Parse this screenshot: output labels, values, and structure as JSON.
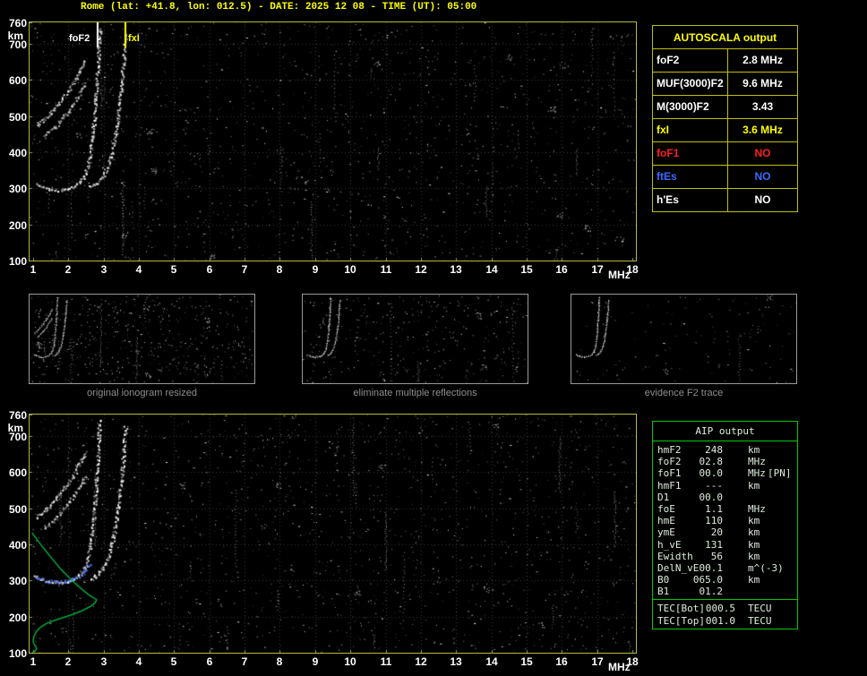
{
  "title": "Rome (lat: +41.8, lon: 012.5) - DATE: 2025 12 08 - TIME (UT): 05:00",
  "colors": {
    "background": "#000000",
    "title_text": "#ffff00",
    "plot_border": "#b9b93c",
    "axis_text": "#ffffff",
    "autoscala_border": "#c0c000",
    "autoscala_header_text": "#ffff00",
    "aip_border": "#00c800",
    "aip_text": "#ddeedd",
    "caption_text": "#8f8f8f",
    "profile_green": "#00c040",
    "fitted_blue": "#5577ff"
  },
  "autoscala_table": {
    "header": "AUTOSCALA output",
    "rows": [
      {
        "label": "foF2",
        "value": "2.8 MHz",
        "color": "#ffffff"
      },
      {
        "label": "MUF(3000)F2",
        "value": "9.6 MHz",
        "color": "#ffffff"
      },
      {
        "label": "M(3000)F2",
        "value": "3.43",
        "color": "#ffffff"
      },
      {
        "label": "fxI",
        "value": "3.6 MHz",
        "color": "#ffff00"
      },
      {
        "label": "foF1",
        "value": "NO",
        "color": "#ff2020"
      },
      {
        "label": "ftEs",
        "value": "NO",
        "color": "#3b6bff"
      },
      {
        "label": "h'Es",
        "value": "NO",
        "color": "#ffffff"
      }
    ]
  },
  "aip_table": {
    "header": "AIP output",
    "rows": [
      {
        "label": "hmF2",
        "value": "248",
        "unit": "km",
        "extra": ""
      },
      {
        "label": "foF2",
        "value": "02.8",
        "unit": "MHz",
        "extra": ""
      },
      {
        "label": "foF1",
        "value": "00.0",
        "unit": "MHz",
        "extra": "[PN]"
      },
      {
        "label": "hmF1",
        "value": "---",
        "unit": "km",
        "extra": ""
      },
      {
        "label": "D1",
        "value": "00.0",
        "unit": "",
        "extra": ""
      },
      {
        "label": "foE",
        "value": "1.1",
        "unit": "MHz",
        "extra": ""
      },
      {
        "label": "hmE",
        "value": "110",
        "unit": "km",
        "extra": ""
      },
      {
        "label": "ymE",
        "value": "20",
        "unit": "km",
        "extra": ""
      },
      {
        "label": "h_vE",
        "value": "131",
        "unit": "km",
        "extra": ""
      },
      {
        "label": "Ewidth",
        "value": "56",
        "unit": "km",
        "extra": ""
      },
      {
        "label": "DelN_vE",
        "value": "00.1",
        "unit": "m^(-3)",
        "extra": ""
      },
      {
        "label": "B0",
        "value": "065.0",
        "unit": "km",
        "extra": ""
      },
      {
        "label": "B1",
        "value": "01.2",
        "unit": "",
        "extra": ""
      }
    ],
    "tec_rows": [
      {
        "label": "TEC[Bot]",
        "value": "000.5",
        "unit": "TECU"
      },
      {
        "label": "TEC[Top]",
        "value": "001.0",
        "unit": "TECU"
      }
    ]
  },
  "thumbnails": [
    {
      "caption": "original ionogram resized"
    },
    {
      "caption": "eliminate multiple reflections"
    },
    {
      "caption": "evidence F2 trace"
    }
  ],
  "chart_data": {
    "type": "scatter",
    "description": "Ionosonde ionogram: echo virtual height (km) vs sounding frequency (MHz); bottom panel adds restored trace (blue) and electron density profile (green)",
    "x_axis": {
      "label": "MHz",
      "min": 1,
      "max": 18,
      "ticks": [
        1,
        2,
        3,
        4,
        5,
        6,
        7,
        8,
        9,
        10,
        11,
        12,
        13,
        14,
        15,
        16,
        17,
        18
      ]
    },
    "y_axis": {
      "label": "km",
      "min": 100,
      "max": 760,
      "ticks": [
        760,
        700,
        600,
        500,
        400,
        300,
        200,
        100
      ]
    },
    "markers": {
      "foF2": {
        "label": "foF2",
        "freq_mhz": 2.8,
        "color": "#ffffff"
      },
      "fxI": {
        "label": "fxI",
        "freq_mhz": 3.6,
        "color": "#ffff00"
      }
    },
    "traces": {
      "o_flat": {
        "color": "#ffffff",
        "points": [
          [
            1.05,
            315
          ],
          [
            1.25,
            305
          ],
          [
            1.5,
            298
          ],
          [
            1.75,
            296
          ],
          [
            2.0,
            300
          ],
          [
            2.2,
            310
          ],
          [
            2.35,
            323
          ],
          [
            2.48,
            342
          ]
        ]
      },
      "o_steep": {
        "color": "#ffffff",
        "points": [
          [
            2.48,
            342
          ],
          [
            2.58,
            380
          ],
          [
            2.66,
            430
          ],
          [
            2.72,
            490
          ],
          [
            2.77,
            555
          ],
          [
            2.81,
            620
          ],
          [
            2.85,
            690
          ],
          [
            2.88,
            748
          ]
        ]
      },
      "x_trace": {
        "color": "#ffffff",
        "points": [
          [
            2.62,
            308
          ],
          [
            2.8,
            316
          ],
          [
            2.95,
            333
          ],
          [
            3.1,
            360
          ],
          [
            3.22,
            398
          ],
          [
            3.33,
            452
          ],
          [
            3.42,
            518
          ],
          [
            3.5,
            588
          ],
          [
            3.56,
            658
          ],
          [
            3.61,
            728
          ]
        ]
      },
      "second_hop_a": {
        "color": "#e8e8e8",
        "points": [
          [
            1.1,
            475
          ],
          [
            1.3,
            492
          ],
          [
            1.52,
            515
          ],
          [
            1.75,
            542
          ],
          [
            1.98,
            572
          ],
          [
            2.18,
            602
          ],
          [
            2.35,
            632
          ],
          [
            2.48,
            660
          ]
        ]
      },
      "second_hop_b": {
        "color": "#d8d8d8",
        "points": [
          [
            1.3,
            445
          ],
          [
            1.5,
            462
          ],
          [
            1.72,
            484
          ],
          [
            1.95,
            510
          ],
          [
            2.15,
            538
          ],
          [
            2.32,
            565
          ],
          [
            2.46,
            590
          ]
        ]
      },
      "fitted_trace_blue": {
        "color": "#5577ff",
        "points": [
          [
            1.05,
            310
          ],
          [
            1.3,
            302
          ],
          [
            1.6,
            297
          ],
          [
            1.9,
            300
          ],
          [
            2.15,
            307
          ],
          [
            2.35,
            318
          ],
          [
            2.52,
            335
          ],
          [
            2.62,
            352
          ]
        ]
      },
      "density_profile_green": {
        "color": "#00c040",
        "style": "line",
        "points": [
          [
            0.97,
            432
          ],
          [
            1.2,
            402
          ],
          [
            1.5,
            365
          ],
          [
            1.8,
            330
          ],
          [
            2.1,
            300
          ],
          [
            2.38,
            276
          ],
          [
            2.6,
            259
          ],
          [
            2.75,
            250
          ],
          [
            2.8,
            247
          ],
          [
            2.76,
            238
          ],
          [
            2.62,
            228
          ],
          [
            2.4,
            217
          ],
          [
            2.15,
            207
          ],
          [
            1.9,
            199
          ],
          [
            1.65,
            191
          ],
          [
            1.4,
            182
          ],
          [
            1.2,
            170
          ],
          [
            1.08,
            157
          ],
          [
            1.02,
            144
          ],
          [
            1.0,
            131
          ],
          [
            1.05,
            120
          ],
          [
            1.1,
            112
          ],
          [
            1.06,
            105
          ],
          [
            0.98,
            100
          ]
        ]
      }
    },
    "panels": {
      "top": {
        "seed": 7,
        "noise": 1500,
        "streaks": 26,
        "clusters": 14,
        "dot": 2,
        "spread": 1.8,
        "grid": true,
        "markers": true,
        "traces": [
          "second_hop_a",
          "second_hop_b",
          "o_flat",
          "o_steep",
          "x_trace"
        ]
      },
      "bottom": {
        "seed": 13,
        "noise": 1500,
        "streaks": 24,
        "clusters": 12,
        "dot": 2,
        "spread": 1.8,
        "grid": true,
        "markers": false,
        "traces": [
          "second_hop_a",
          "second_hop_b",
          "o_flat",
          "o_steep",
          "x_trace",
          "fitted_trace_blue",
          "density_profile_green"
        ]
      },
      "thumb1": {
        "seed": 21,
        "noise": 520,
        "streaks": 8,
        "clusters": 6,
        "dot": 1,
        "spread": 0.7,
        "grid": false,
        "markers": false,
        "traces": [
          "second_hop_a",
          "second_hop_b",
          "o_flat",
          "o_steep",
          "x_trace"
        ]
      },
      "thumb2": {
        "seed": 33,
        "noise": 340,
        "streaks": 5,
        "clusters": 4,
        "dot": 1,
        "spread": 0.7,
        "grid": false,
        "markers": false,
        "traces": [
          "o_flat",
          "o_steep",
          "x_trace"
        ]
      },
      "thumb3": {
        "seed": 44,
        "noise": 140,
        "streaks": 2,
        "clusters": 2,
        "dot": 1,
        "spread": 0.7,
        "grid": false,
        "markers": false,
        "traces": [
          "o_flat",
          "o_steep",
          "x_trace"
        ]
      }
    }
  }
}
